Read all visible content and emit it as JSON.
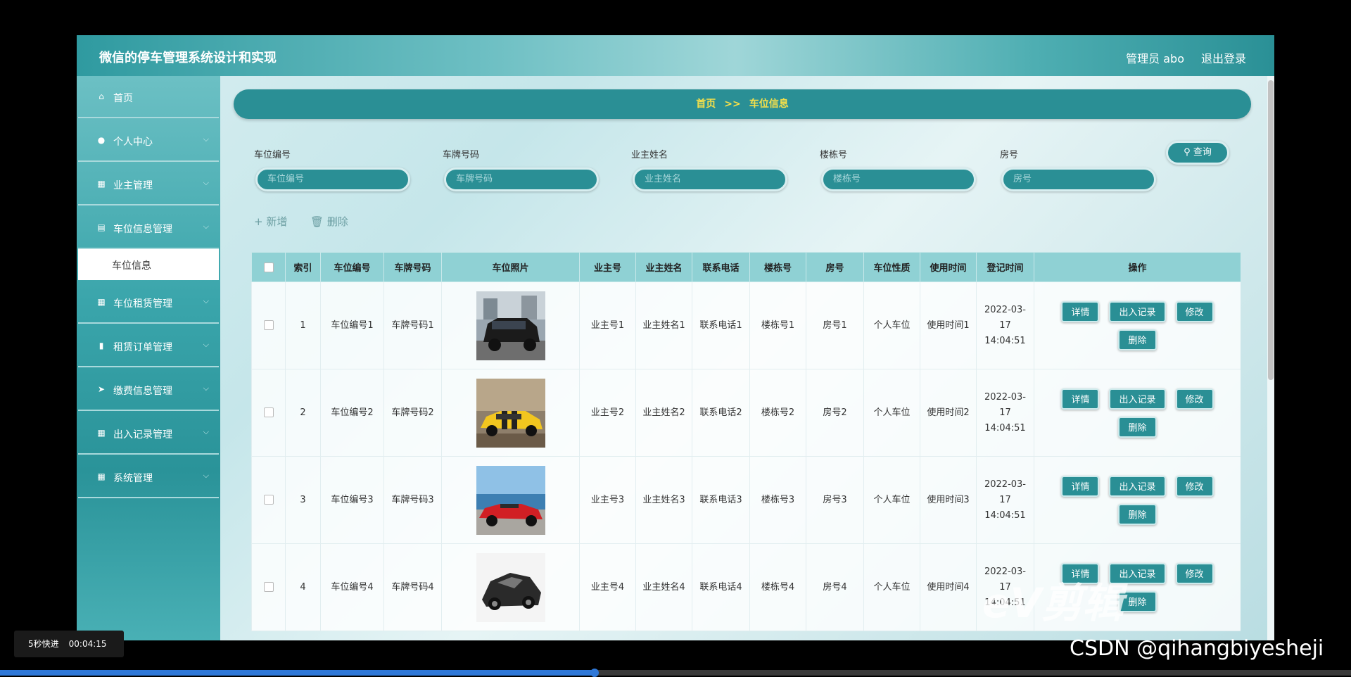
{
  "app": {
    "title": "微信的停车管理系统设计和实现",
    "user_label": "管理员 abo",
    "logout_label": "退出登录"
  },
  "sidebar": {
    "items": [
      {
        "label": "首页",
        "icon": "home-icon"
      },
      {
        "label": "个人中心",
        "icon": "user-icon"
      },
      {
        "label": "业主管理",
        "icon": "grid-icon"
      },
      {
        "label": "车位信息管理",
        "icon": "chart-icon"
      },
      {
        "label": "车位租赁管理",
        "icon": "grid-icon"
      },
      {
        "label": "租赁订单管理",
        "icon": "bar-chart-icon"
      },
      {
        "label": "缴费信息管理",
        "icon": "send-icon"
      },
      {
        "label": "出入记录管理",
        "icon": "grid-icon"
      },
      {
        "label": "系统管理",
        "icon": "grid-icon"
      }
    ],
    "sub_item_active": "车位信息"
  },
  "breadcrumb": {
    "home": "首页",
    "separator": ">>",
    "current": "车位信息"
  },
  "filters": {
    "fields": [
      {
        "label": "车位编号",
        "placeholder": "车位编号"
      },
      {
        "label": "车牌号码",
        "placeholder": "车牌号码"
      },
      {
        "label": "业主姓名",
        "placeholder": "业主姓名"
      },
      {
        "label": "楼栋号",
        "placeholder": "楼栋号"
      },
      {
        "label": "房号",
        "placeholder": "房号"
      }
    ],
    "query_label": "查询"
  },
  "toolbar": {
    "add_label": "新增",
    "delete_label": "删除"
  },
  "table": {
    "headers": [
      "索引",
      "车位编号",
      "车牌号码",
      "车位照片",
      "业主号",
      "业主姓名",
      "联系电话",
      "楼栋号",
      "房号",
      "车位性质",
      "使用时间",
      "登记时间",
      "操作"
    ],
    "rows": [
      {
        "index": "1",
        "spot_no": "车位编号1",
        "plate": "车牌号码1",
        "owner_no": "业主号1",
        "owner_name": "业主姓名1",
        "phone": "联系电话1",
        "building": "楼栋号1",
        "room": "房号1",
        "nature": "个人车位",
        "use_time": "使用时间1",
        "reg_time": "2022-03-17 14:04:51",
        "photo": "black-suv"
      },
      {
        "index": "2",
        "spot_no": "车位编号2",
        "plate": "车牌号码2",
        "owner_no": "业主号2",
        "owner_name": "业主姓名2",
        "phone": "联系电话2",
        "building": "楼栋号2",
        "room": "房号2",
        "nature": "个人车位",
        "use_time": "使用时间2",
        "reg_time": "2022-03-17 14:04:51",
        "photo": "yellow-sports-car"
      },
      {
        "index": "3",
        "spot_no": "车位编号3",
        "plate": "车牌号码3",
        "owner_no": "业主号3",
        "owner_name": "业主姓名3",
        "phone": "联系电话3",
        "building": "楼栋号3",
        "room": "房号3",
        "nature": "个人车位",
        "use_time": "使用时间3",
        "reg_time": "2022-03-17 14:04:51",
        "photo": "red-convertible"
      },
      {
        "index": "4",
        "spot_no": "车位编号4",
        "plate": "车牌号码4",
        "owner_no": "业主号4",
        "owner_name": "业主姓名4",
        "phone": "联系电话4",
        "building": "楼栋号4",
        "room": "房号4",
        "nature": "个人车位",
        "use_time": "使用时间4",
        "reg_time": "2022-03-17 14:04:51",
        "photo": "black-supercar"
      }
    ],
    "actions": [
      "详情",
      "出入记录",
      "修改",
      "删除"
    ]
  },
  "player": {
    "speed_label": "5秒快进",
    "timestamp": "00:04:15",
    "progress": 0.44,
    "watermark": "CSDN @qihangbiyesheji",
    "editor_logo": "eV剪辑"
  },
  "colors": {
    "accent": "#2a8f95",
    "header_bg": "#8fd1d4",
    "crumb_text": "#f6e04a"
  }
}
